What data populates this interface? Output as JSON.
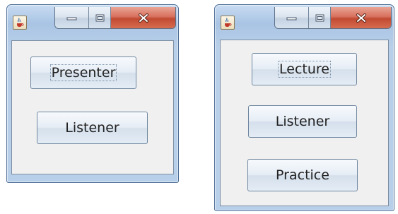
{
  "windows": [
    {
      "icon": "java-cup-icon",
      "caption_buttons": [
        "minimize-icon",
        "maximize-icon",
        "close-icon"
      ],
      "buttons": [
        {
          "label": "Presenter",
          "focused": true
        },
        {
          "label": "Listener",
          "focused": false
        }
      ]
    },
    {
      "icon": "java-cup-icon",
      "caption_buttons": [
        "minimize-icon",
        "maximize-icon",
        "close-icon"
      ],
      "buttons": [
        {
          "label": "Lecture",
          "focused": true
        },
        {
          "label": "Listener",
          "focused": false
        },
        {
          "label": "Practice",
          "focused": false
        }
      ]
    }
  ],
  "colors": {
    "frame": "#b8cfe9",
    "client": "#f0f0f0",
    "close": "#c14a33"
  }
}
